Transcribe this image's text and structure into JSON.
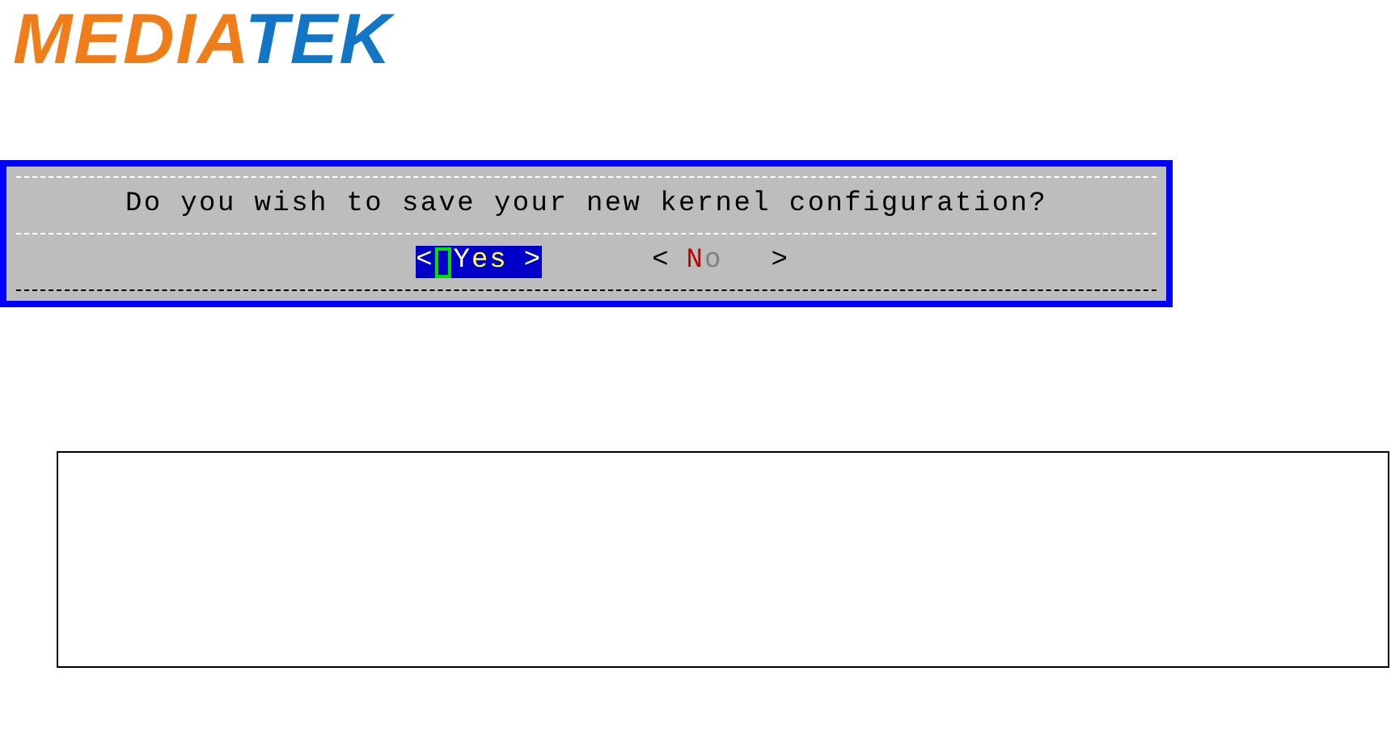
{
  "logo": {
    "first": "MEDIA",
    "second": "TEK"
  },
  "dialog": {
    "message": "Do you wish to save your new kernel configuration?",
    "buttons": [
      {
        "left": "<",
        "hotkey": "Y",
        "rest": "es",
        "right": ">",
        "selected": true
      },
      {
        "left": "<",
        "hotkey": "N",
        "rest": "o",
        "right": ">",
        "selected": false
      }
    ]
  }
}
